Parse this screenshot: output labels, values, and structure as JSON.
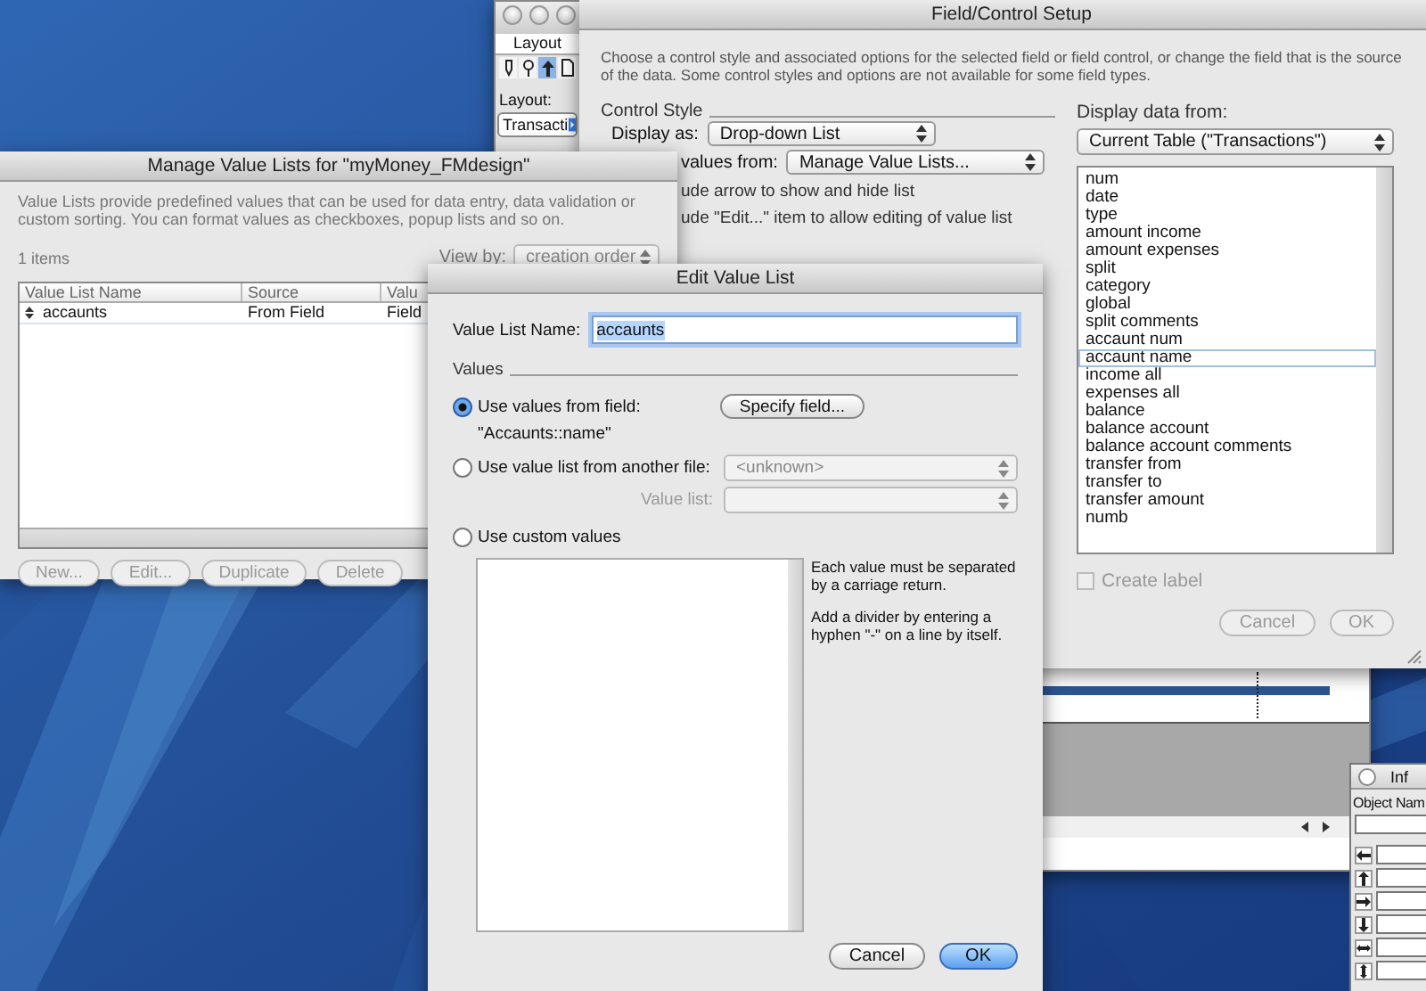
{
  "layout_window": {
    "palette_title": "Layout",
    "tools": [
      {
        "selected": false
      },
      {
        "selected": false
      },
      {
        "selected": true
      },
      {
        "selected": false
      }
    ],
    "layout_label": "Layout:",
    "layout_popup": "Transacti"
  },
  "field_control_setup": {
    "title": "Field/Control Setup",
    "description": "Choose a control style and associated options for the selected field or field control, or change the field that is the source of the data. Some control styles and options are not available for some field types.",
    "control_style_heading": "Control Style",
    "display_as_label": "Display as:",
    "display_as_value": "Drop-down List",
    "values_from_label": "values from:",
    "values_from_value": "Manage Value Lists...",
    "options": [
      "ude arrow to show and hide list",
      "ude \"Edit...\" item to allow editing of value list"
    ],
    "display_data_label": "Display data from:",
    "table_popup": "Current Table (\"Transactions\")",
    "fields": [
      {
        "name": "num",
        "selected": false
      },
      {
        "name": "date",
        "selected": false
      },
      {
        "name": "type",
        "selected": false
      },
      {
        "name": "amount income",
        "selected": false
      },
      {
        "name": "amount expenses",
        "selected": false
      },
      {
        "name": "split",
        "selected": false
      },
      {
        "name": "category",
        "selected": false
      },
      {
        "name": "global",
        "selected": false
      },
      {
        "name": "split comments",
        "selected": false
      },
      {
        "name": "accaunt num",
        "selected": false
      },
      {
        "name": "accaunt name",
        "selected": true
      },
      {
        "name": "income all",
        "selected": false
      },
      {
        "name": "expenses all",
        "selected": false
      },
      {
        "name": "balance",
        "selected": false
      },
      {
        "name": "balance account",
        "selected": false
      },
      {
        "name": "balance account comments",
        "selected": false
      },
      {
        "name": "transfer from",
        "selected": false
      },
      {
        "name": "transfer to",
        "selected": false
      },
      {
        "name": "transfer amount",
        "selected": false
      },
      {
        "name": "numb",
        "selected": false
      }
    ],
    "create_label": {
      "label": "Create label",
      "checked": false,
      "disabled": true
    },
    "buttons": [
      {
        "label": "Cancel",
        "disabled": true
      },
      {
        "label": "OK",
        "disabled": true
      }
    ]
  },
  "manage_value_lists": {
    "title": "Manage Value Lists for \"myMoney_FMdesign\"",
    "description": "Value Lists provide predefined values that can be used for data entry, data validation or custom sorting. You can format values as checkboxes, popup lists and so on.",
    "count": "1 items",
    "view_by_label": "View by:",
    "view_by_value": "creation order",
    "columns": [
      "Value List Name",
      "Source",
      "Valu"
    ],
    "rows": [
      {
        "cells": [
          "accaunts",
          "From Field",
          "Field"
        ],
        "selected": false
      }
    ],
    "buttons": [
      {
        "label": "New...",
        "disabled": true
      },
      {
        "label": "Edit...",
        "disabled": true
      },
      {
        "label": "Duplicate",
        "disabled": true
      },
      {
        "label": "Delete",
        "disabled": true
      }
    ]
  },
  "edit_value_list": {
    "title": "Edit Value List",
    "name_label": "Value List Name:",
    "name_value": "accaunts",
    "values_heading": "Values",
    "sources": [
      {
        "label": "Use values from field:",
        "selected": true
      },
      {
        "label": "Use value list from another file:",
        "selected": false
      },
      {
        "label": "Use custom values",
        "selected": false
      }
    ],
    "specify_button": "Specify field...",
    "field_source": "\"Accaunts::name\"",
    "file_popup": {
      "value": "<unknown>",
      "disabled": true
    },
    "value_list_label": "Value list:",
    "help": [
      "Each value must be separated by a carriage return.",
      "Add a divider by entering a hyphen \"-\" on a line by itself."
    ],
    "buttons": [
      {
        "label": "Cancel",
        "default": false
      },
      {
        "label": "OK",
        "default": true
      }
    ]
  },
  "info_palette": {
    "title": "Inf",
    "object_name_label": "Object Nam"
  }
}
